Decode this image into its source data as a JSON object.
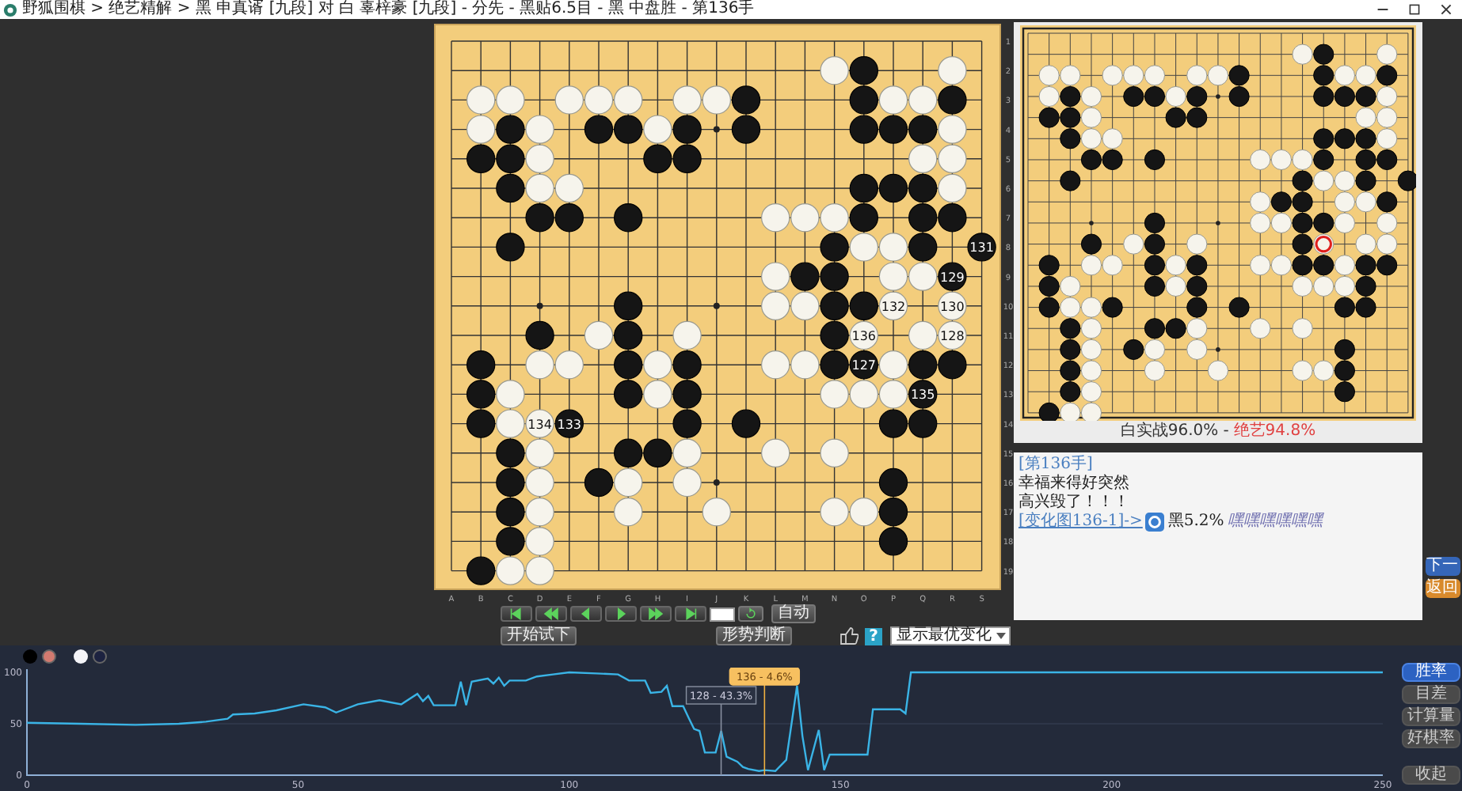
{
  "window": {
    "title": "野狐围棋 > 绝艺精解 > 黑 申真谞 [九段] 对 白 辜梓豪 [九段] - 分先 - 黑贴6.5目 - 黑 中盘胜 - 第136手"
  },
  "position": {
    "rows": [
      [
        {
          "kind": "empty"
        },
        {
          "kind": "empty"
        },
        {
          "kind": "empty"
        },
        {
          "kind": "empty"
        },
        {
          "kind": "empty"
        },
        {
          "kind": "empty"
        },
        {
          "kind": "empty"
        },
        {
          "kind": "empty"
        },
        {
          "kind": "empty"
        },
        {
          "kind": "empty"
        },
        {
          "kind": "empty"
        },
        {
          "kind": "empty"
        },
        {
          "kind": "empty"
        },
        {
          "kind": "empty"
        },
        {
          "kind": "empty"
        },
        {
          "kind": "empty"
        },
        {
          "kind": "empty"
        },
        {
          "kind": "empty"
        },
        {
          "kind": "empty"
        }
      ],
      [
        {
          "kind": "empty"
        },
        {
          "kind": "empty"
        },
        {
          "kind": "empty"
        },
        {
          "kind": "empty"
        },
        {
          "kind": "empty"
        },
        {
          "kind": "empty"
        },
        {
          "kind": "empty"
        },
        {
          "kind": "empty"
        },
        {
          "kind": "empty"
        },
        {
          "kind": "empty"
        },
        {
          "kind": "empty"
        },
        {
          "kind": "empty"
        },
        {
          "kind": "empty"
        },
        {
          "kind": "white"
        },
        {
          "kind": "black"
        },
        {
          "kind": "empty"
        },
        {
          "kind": "empty"
        },
        {
          "kind": "white"
        },
        {
          "kind": "empty"
        }
      ],
      [
        {
          "kind": "empty"
        },
        {
          "kind": "white"
        },
        {
          "kind": "white"
        },
        {
          "kind": "empty"
        },
        {
          "kind": "white"
        },
        {
          "kind": "white"
        },
        {
          "kind": "white"
        },
        {
          "kind": "empty"
        },
        {
          "kind": "white"
        },
        {
          "kind": "white"
        },
        {
          "kind": "black"
        },
        {
          "kind": "empty"
        },
        {
          "kind": "empty"
        },
        {
          "kind": "empty"
        },
        {
          "kind": "black"
        },
        {
          "kind": "white"
        },
        {
          "kind": "white"
        },
        {
          "kind": "black"
        },
        {
          "kind": "empty"
        }
      ],
      [
        {
          "kind": "empty"
        },
        {
          "kind": "white"
        },
        {
          "kind": "black"
        },
        {
          "kind": "white"
        },
        {
          "kind": "empty"
        },
        {
          "kind": "black"
        },
        {
          "kind": "black"
        },
        {
          "kind": "white"
        },
        {
          "kind": "black"
        },
        {
          "kind": "empty"
        },
        {
          "kind": "black"
        },
        {
          "kind": "empty"
        },
        {
          "kind": "empty"
        },
        {
          "kind": "empty"
        },
        {
          "kind": "black"
        },
        {
          "kind": "black"
        },
        {
          "kind": "black"
        },
        {
          "kind": "white"
        },
        {
          "kind": "empty"
        }
      ],
      [
        {
          "kind": "empty"
        },
        {
          "kind": "black"
        },
        {
          "kind": "black"
        },
        {
          "kind": "white"
        },
        {
          "kind": "empty"
        },
        {
          "kind": "empty"
        },
        {
          "kind": "empty"
        },
        {
          "kind": "black"
        },
        {
          "kind": "black"
        },
        {
          "kind": "empty"
        },
        {
          "kind": "empty"
        },
        {
          "kind": "empty"
        },
        {
          "kind": "empty"
        },
        {
          "kind": "empty"
        },
        {
          "kind": "empty"
        },
        {
          "kind": "empty"
        },
        {
          "kind": "white"
        },
        {
          "kind": "white"
        },
        {
          "kind": "empty"
        }
      ],
      [
        {
          "kind": "empty"
        },
        {
          "kind": "empty"
        },
        {
          "kind": "black"
        },
        {
          "kind": "white"
        },
        {
          "kind": "white"
        },
        {
          "kind": "empty"
        },
        {
          "kind": "empty"
        },
        {
          "kind": "empty"
        },
        {
          "kind": "empty"
        },
        {
          "kind": "empty"
        },
        {
          "kind": "empty"
        },
        {
          "kind": "empty"
        },
        {
          "kind": "empty"
        },
        {
          "kind": "empty"
        },
        {
          "kind": "black"
        },
        {
          "kind": "black"
        },
        {
          "kind": "black"
        },
        {
          "kind": "white"
        },
        {
          "kind": "empty"
        }
      ],
      [
        {
          "kind": "empty"
        },
        {
          "kind": "empty"
        },
        {
          "kind": "empty"
        },
        {
          "kind": "black"
        },
        {
          "kind": "black"
        },
        {
          "kind": "empty"
        },
        {
          "kind": "black"
        },
        {
          "kind": "empty"
        },
        {
          "kind": "empty"
        },
        {
          "kind": "empty"
        },
        {
          "kind": "empty"
        },
        {
          "kind": "white"
        },
        {
          "kind": "white"
        },
        {
          "kind": "white"
        },
        {
          "kind": "black"
        },
        {
          "kind": "empty"
        },
        {
          "kind": "black"
        },
        {
          "kind": "black"
        },
        {
          "kind": "empty"
        }
      ],
      [
        {
          "kind": "empty"
        },
        {
          "kind": "empty"
        },
        {
          "kind": "black"
        },
        {
          "kind": "empty"
        },
        {
          "kind": "empty"
        },
        {
          "kind": "empty"
        },
        {
          "kind": "empty"
        },
        {
          "kind": "empty"
        },
        {
          "kind": "empty"
        },
        {
          "kind": "empty"
        },
        {
          "kind": "empty"
        },
        {
          "kind": "empty"
        },
        {
          "kind": "empty"
        },
        {
          "kind": "black"
        },
        {
          "kind": "white"
        },
        {
          "kind": "white"
        },
        {
          "kind": "black"
        },
        {
          "kind": "empty"
        },
        {
          "kind": "black",
          "number": "131"
        }
      ],
      [
        {
          "kind": "empty"
        },
        {
          "kind": "empty"
        },
        {
          "kind": "empty"
        },
        {
          "kind": "empty"
        },
        {
          "kind": "empty"
        },
        {
          "kind": "empty"
        },
        {
          "kind": "empty"
        },
        {
          "kind": "empty"
        },
        {
          "kind": "empty"
        },
        {
          "kind": "empty"
        },
        {
          "kind": "empty"
        },
        {
          "kind": "white"
        },
        {
          "kind": "black"
        },
        {
          "kind": "black"
        },
        {
          "kind": "empty"
        },
        {
          "kind": "white"
        },
        {
          "kind": "white"
        },
        {
          "kind": "black",
          "number": "129"
        },
        {
          "kind": "empty"
        }
      ],
      [
        {
          "kind": "empty"
        },
        {
          "kind": "empty"
        },
        {
          "kind": "empty"
        },
        {
          "kind": "empty"
        },
        {
          "kind": "empty"
        },
        {
          "kind": "empty"
        },
        {
          "kind": "black"
        },
        {
          "kind": "empty"
        },
        {
          "kind": "empty"
        },
        {
          "kind": "empty"
        },
        {
          "kind": "empty"
        },
        {
          "kind": "white"
        },
        {
          "kind": "white"
        },
        {
          "kind": "black"
        },
        {
          "kind": "black"
        },
        {
          "kind": "white",
          "number": "132"
        },
        {
          "kind": "empty"
        },
        {
          "kind": "white",
          "number": "130"
        },
        {
          "kind": "empty"
        }
      ],
      [
        {
          "kind": "empty"
        },
        {
          "kind": "empty"
        },
        {
          "kind": "empty"
        },
        {
          "kind": "black"
        },
        {
          "kind": "empty"
        },
        {
          "kind": "white"
        },
        {
          "kind": "black"
        },
        {
          "kind": "empty"
        },
        {
          "kind": "white"
        },
        {
          "kind": "empty"
        },
        {
          "kind": "empty"
        },
        {
          "kind": "empty"
        },
        {
          "kind": "empty"
        },
        {
          "kind": "black"
        },
        {
          "kind": "last",
          "number": "136"
        },
        {
          "kind": "empty"
        },
        {
          "kind": "white"
        },
        {
          "kind": "white",
          "number": "128"
        },
        {
          "kind": "empty"
        }
      ],
      [
        {
          "kind": "empty"
        },
        {
          "kind": "black"
        },
        {
          "kind": "empty"
        },
        {
          "kind": "white"
        },
        {
          "kind": "white"
        },
        {
          "kind": "empty"
        },
        {
          "kind": "black"
        },
        {
          "kind": "white"
        },
        {
          "kind": "black"
        },
        {
          "kind": "empty"
        },
        {
          "kind": "empty"
        },
        {
          "kind": "white"
        },
        {
          "kind": "white"
        },
        {
          "kind": "black"
        },
        {
          "kind": "black",
          "number": "127"
        },
        {
          "kind": "white"
        },
        {
          "kind": "black"
        },
        {
          "kind": "black"
        },
        {
          "kind": "empty"
        }
      ],
      [
        {
          "kind": "empty"
        },
        {
          "kind": "black"
        },
        {
          "kind": "white"
        },
        {
          "kind": "empty"
        },
        {
          "kind": "empty"
        },
        {
          "kind": "empty"
        },
        {
          "kind": "black"
        },
        {
          "kind": "white"
        },
        {
          "kind": "black"
        },
        {
          "kind": "empty"
        },
        {
          "kind": "empty"
        },
        {
          "kind": "empty"
        },
        {
          "kind": "empty"
        },
        {
          "kind": "white"
        },
        {
          "kind": "white"
        },
        {
          "kind": "white"
        },
        {
          "kind": "black",
          "number": "135"
        },
        {
          "kind": "empty"
        },
        {
          "kind": "empty"
        }
      ],
      [
        {
          "kind": "empty"
        },
        {
          "kind": "black"
        },
        {
          "kind": "white"
        },
        {
          "kind": "white",
          "number": "134"
        },
        {
          "kind": "black",
          "number": "133"
        },
        {
          "kind": "empty"
        },
        {
          "kind": "empty"
        },
        {
          "kind": "empty"
        },
        {
          "kind": "black"
        },
        {
          "kind": "empty"
        },
        {
          "kind": "black"
        },
        {
          "kind": "empty"
        },
        {
          "kind": "empty"
        },
        {
          "kind": "empty"
        },
        {
          "kind": "empty"
        },
        {
          "kind": "black"
        },
        {
          "kind": "black"
        },
        {
          "kind": "empty"
        },
        {
          "kind": "empty"
        }
      ],
      [
        {
          "kind": "empty"
        },
        {
          "kind": "empty"
        },
        {
          "kind": "black"
        },
        {
          "kind": "white"
        },
        {
          "kind": "empty"
        },
        {
          "kind": "empty"
        },
        {
          "kind": "black"
        },
        {
          "kind": "black"
        },
        {
          "kind": "white"
        },
        {
          "kind": "empty"
        },
        {
          "kind": "empty"
        },
        {
          "kind": "white"
        },
        {
          "kind": "empty"
        },
        {
          "kind": "white"
        },
        {
          "kind": "empty"
        },
        {
          "kind": "empty"
        },
        {
          "kind": "empty"
        },
        {
          "kind": "empty"
        },
        {
          "kind": "empty"
        }
      ],
      [
        {
          "kind": "empty"
        },
        {
          "kind": "empty"
        },
        {
          "kind": "black"
        },
        {
          "kind": "white"
        },
        {
          "kind": "empty"
        },
        {
          "kind": "black"
        },
        {
          "kind": "white"
        },
        {
          "kind": "empty"
        },
        {
          "kind": "white"
        },
        {
          "kind": "empty"
        },
        {
          "kind": "empty"
        },
        {
          "kind": "empty"
        },
        {
          "kind": "empty"
        },
        {
          "kind": "empty"
        },
        {
          "kind": "empty"
        },
        {
          "kind": "black"
        },
        {
          "kind": "empty"
        },
        {
          "kind": "empty"
        },
        {
          "kind": "empty"
        }
      ],
      [
        {
          "kind": "empty"
        },
        {
          "kind": "empty"
        },
        {
          "kind": "black"
        },
        {
          "kind": "white"
        },
        {
          "kind": "empty"
        },
        {
          "kind": "empty"
        },
        {
          "kind": "white"
        },
        {
          "kind": "empty"
        },
        {
          "kind": "empty"
        },
        {
          "kind": "white"
        },
        {
          "kind": "empty"
        },
        {
          "kind": "empty"
        },
        {
          "kind": "empty"
        },
        {
          "kind": "white"
        },
        {
          "kind": "white"
        },
        {
          "kind": "black"
        },
        {
          "kind": "empty"
        },
        {
          "kind": "empty"
        },
        {
          "kind": "empty"
        }
      ],
      [
        {
          "kind": "empty"
        },
        {
          "kind": "empty"
        },
        {
          "kind": "black"
        },
        {
          "kind": "white"
        },
        {
          "kind": "empty"
        },
        {
          "kind": "empty"
        },
        {
          "kind": "empty"
        },
        {
          "kind": "empty"
        },
        {
          "kind": "empty"
        },
        {
          "kind": "empty"
        },
        {
          "kind": "empty"
        },
        {
          "kind": "empty"
        },
        {
          "kind": "empty"
        },
        {
          "kind": "empty"
        },
        {
          "kind": "empty"
        },
        {
          "kind": "black"
        },
        {
          "kind": "empty"
        },
        {
          "kind": "empty"
        },
        {
          "kind": "empty"
        }
      ],
      [
        {
          "kind": "empty"
        },
        {
          "kind": "black"
        },
        {
          "kind": "white"
        },
        {
          "kind": "white"
        },
        {
          "kind": "empty"
        },
        {
          "kind": "empty"
        },
        {
          "kind": "empty"
        },
        {
          "kind": "empty"
        },
        {
          "kind": "empty"
        },
        {
          "kind": "empty"
        },
        {
          "kind": "empty"
        },
        {
          "kind": "empty"
        },
        {
          "kind": "empty"
        },
        {
          "kind": "empty"
        },
        {
          "kind": "empty"
        },
        {
          "kind": "empty"
        },
        {
          "kind": "empty"
        },
        {
          "kind": "empty"
        },
        {
          "kind": "empty"
        }
      ]
    ]
  },
  "main_board": {
    "column_labels": [
      "A",
      "B",
      "C",
      "D",
      "E",
      "F",
      "G",
      "H",
      "I",
      "J",
      "K",
      "L",
      "M",
      "N",
      "O",
      "P",
      "Q",
      "R",
      "S"
    ],
    "row_labels": [
      "1",
      "2",
      "3",
      "4",
      "5",
      "6",
      "7",
      "8",
      "9",
      "10",
      "11",
      "12",
      "13",
      "14",
      "15",
      "16",
      "17",
      "18",
      "19"
    ]
  },
  "mini_board": {
    "caption": {
      "actual": "白实战96.0%",
      "separator": "-",
      "ai": "绝艺94.8%"
    }
  },
  "comment": {
    "lines": [
      {
        "kind": "heading",
        "text": "[第136手]"
      },
      {
        "kind": "text",
        "text": "幸福来得好突然"
      },
      {
        "kind": "text",
        "text": "高兴毁了！！！"
      }
    ],
    "variation": {
      "link": "[变化图136-1]->",
      "rate": "黑5.2%",
      "remark": "嘿嘿嘿嘿嘿嘿"
    }
  },
  "side_buttons": [
    {
      "label": "下一",
      "kind": "primary"
    },
    {
      "label": "返回",
      "kind": "warning"
    }
  ],
  "controls": {
    "nav_buttons": [
      {
        "kind": "first"
      },
      {
        "kind": "fast-back"
      },
      {
        "kind": "back"
      },
      {
        "kind": "forward"
      },
      {
        "kind": "fast-forward"
      },
      {
        "kind": "last"
      }
    ],
    "auto_button": "自动",
    "try_button": "开始试下",
    "judge_button": "形势判断",
    "help_button": "?",
    "variation_select": {
      "value": "显示最优变化"
    }
  },
  "chart": {
    "tabs": [
      {
        "label": "胜率",
        "selected": true
      },
      {
        "label": "目差",
        "selected": false
      },
      {
        "label": "计算量",
        "selected": false
      },
      {
        "label": "好棋率",
        "selected": false
      }
    ],
    "collapse_button": "收起",
    "chart_data": {
      "type": "line",
      "xlim": [
        0,
        250
      ],
      "ylim": [
        0,
        100
      ],
      "xticks": [
        0,
        50,
        100,
        150,
        200,
        250
      ],
      "yticks": [
        0,
        50,
        100
      ],
      "x": [
        0,
        10,
        20,
        28,
        33,
        37,
        38,
        42,
        46,
        51,
        55,
        57,
        61,
        65,
        69,
        72,
        73,
        74,
        75,
        79,
        80,
        81,
        82,
        85,
        86,
        87,
        88,
        89,
        92,
        94,
        97,
        100,
        105,
        109,
        111,
        114,
        115,
        117,
        118,
        119,
        121,
        122,
        123,
        124,
        125,
        127,
        128,
        129,
        131,
        132,
        133,
        135,
        136,
        138,
        140,
        142,
        143,
        144,
        146,
        147,
        148,
        155,
        156,
        161,
        162,
        163,
        250
      ],
      "series": [
        {
          "color": "#3ab4e6",
          "values": [
            51,
            50,
            49,
            50,
            52,
            55,
            59,
            60,
            63,
            69,
            66,
            61,
            69,
            73,
            69,
            79,
            72,
            77,
            68,
            68,
            91,
            68,
            91,
            94,
            89,
            95,
            87,
            92,
            92,
            96,
            98,
            100,
            99,
            98,
            92,
            92,
            80,
            81,
            87,
            67,
            67,
            56,
            45,
            43,
            22,
            22,
            43,
            18,
            13,
            8,
            6,
            4,
            5,
            4,
            15,
            87,
            38,
            5,
            44,
            5,
            20,
            20,
            64,
            64,
            60,
            100,
            100
          ]
        }
      ],
      "annotations": [
        {
          "x": 128,
          "text": "128 - 43.3%"
        },
        {
          "x": 136,
          "text": "136 - 4.6%"
        }
      ]
    }
  }
}
